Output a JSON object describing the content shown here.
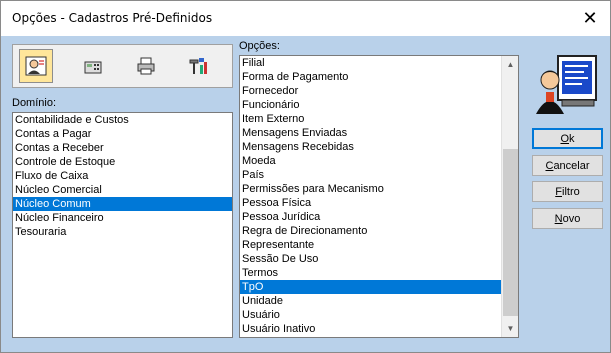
{
  "window": {
    "title": "Opções - Cadastros Pré-Definidos",
    "close_glyph": "✕"
  },
  "toolbar": {
    "buttons": [
      {
        "icon": "person-card-icon",
        "active": true
      },
      {
        "icon": "calculator-icon",
        "active": false
      },
      {
        "icon": "printer-icon",
        "active": false
      },
      {
        "icon": "tools-icon",
        "active": false
      }
    ]
  },
  "dominio": {
    "label": "Domínio:",
    "items": [
      "Contabilidade e Custos",
      "Contas a Pagar",
      "Contas a Receber",
      "Controle de Estoque",
      "Fluxo de Caixa",
      "Núcleo Comercial",
      "Núcleo Comum",
      "Núcleo Financeiro",
      "Tesouraria"
    ],
    "selected_index": 6
  },
  "opcoes": {
    "label": "Opções:",
    "items": [
      "Filial",
      "Forma de Pagamento",
      "Fornecedor",
      "Funcionário",
      "Item Externo",
      "Mensagens Enviadas",
      "Mensagens Recebidas",
      "Moeda",
      "País",
      "Permissões para Mecanismo",
      "Pessoa Física",
      "Pessoa Jurídica",
      "Regra de Direcionamento",
      "Representante",
      "Sessão De Uso",
      "Termos",
      "TpO",
      "Unidade",
      "Usuário",
      "Usuário Inativo"
    ],
    "selected_index": 16
  },
  "buttons": {
    "ok": {
      "pre": "",
      "ul": "O",
      "post": "k"
    },
    "cancel": {
      "pre": "",
      "ul": "C",
      "post": "ancelar"
    },
    "filter": {
      "pre": "",
      "ul": "F",
      "post": "iltro"
    },
    "new": {
      "pre": "",
      "ul": "N",
      "post": "ovo"
    }
  },
  "illustration": {
    "icon": "person-at-computer-icon"
  },
  "colors": {
    "selection": "#0078d7",
    "client_bg": "#b9d1ea",
    "active_tool": "#ffe69a"
  }
}
